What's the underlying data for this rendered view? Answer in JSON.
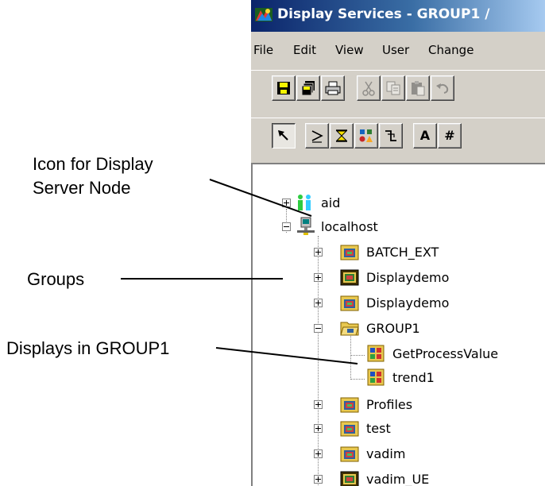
{
  "annotations": {
    "display_server_node": "Icon for Display Server Node",
    "groups": "Groups",
    "displays_in_group": "Displays in GROUP1"
  },
  "window": {
    "title": "Display Services - GROUP1 /",
    "app_icon": "display-services-app-icon",
    "title_bar_color": "#0a246a"
  },
  "menu": {
    "items": [
      "File",
      "Edit",
      "View",
      "User",
      "Change"
    ]
  },
  "toolbar_standard": {
    "buttons": [
      {
        "icon": "save-icon",
        "enabled": true
      },
      {
        "icon": "save-all-icon",
        "enabled": true
      },
      {
        "icon": "print-icon",
        "enabled": true
      },
      {
        "icon": "cut-icon",
        "enabled": false
      },
      {
        "icon": "copy-icon",
        "enabled": false
      },
      {
        "icon": "paste-icon",
        "enabled": false
      },
      {
        "icon": "undo-icon",
        "enabled": false
      }
    ]
  },
  "toolbar_draw": {
    "buttons": [
      {
        "icon": "select-arrow-icon",
        "pressed": true
      },
      {
        "icon": "line-tool-icon"
      },
      {
        "icon": "bowtie-tool-icon"
      },
      {
        "icon": "shapes-tool-icon"
      },
      {
        "icon": "step-line-tool-icon"
      },
      {
        "icon": "text-tool-icon",
        "text": "A"
      },
      {
        "icon": "number-tool-icon",
        "text": "#"
      }
    ]
  },
  "tree": {
    "nodes": [
      {
        "label": "aid",
        "icon": "users-icon",
        "expander": "plus"
      },
      {
        "label": "localhost",
        "icon": "computer-node-icon",
        "expander": "minus"
      },
      {
        "label": "BATCH_EXT",
        "icon": "folder-group-icon",
        "expander": "plus"
      },
      {
        "label": "Displaydemo",
        "icon": "folder-group-icon",
        "expander": "plus"
      },
      {
        "label": "Displaydemo",
        "icon": "folder-group-icon",
        "expander": "plus"
      },
      {
        "label": "GROUP1",
        "icon": "open-folder-group-icon",
        "expander": "minus"
      },
      {
        "label": "GetProcessValue",
        "icon": "display-file-icon"
      },
      {
        "label": "trend1",
        "icon": "display-file-icon"
      },
      {
        "label": "Profiles",
        "icon": "folder-group-icon",
        "expander": "plus"
      },
      {
        "label": "test",
        "icon": "folder-group-icon",
        "expander": "plus"
      },
      {
        "label": "vadim",
        "icon": "folder-group-icon",
        "expander": "plus"
      },
      {
        "label": "vadim_UE",
        "icon": "folder-group-icon",
        "expander": "plus"
      }
    ]
  }
}
